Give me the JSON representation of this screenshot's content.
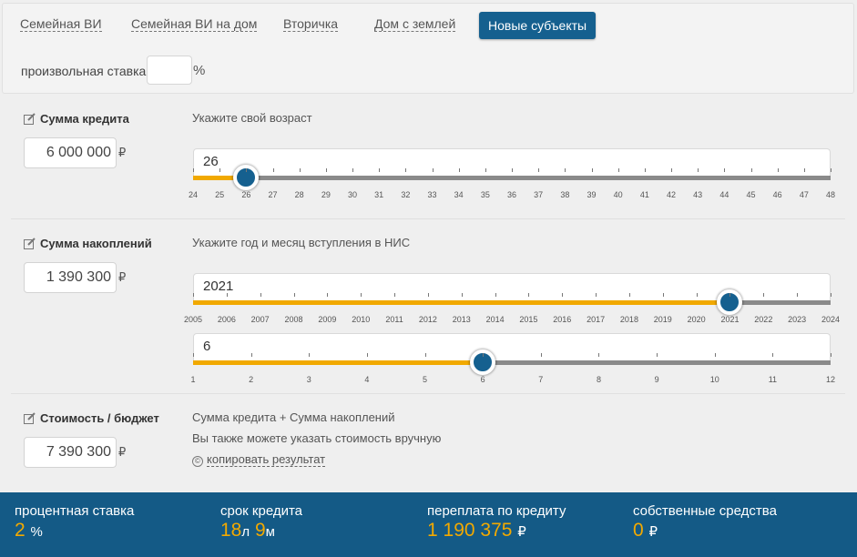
{
  "tabs": [
    {
      "label": "Семейная ВИ",
      "active": false
    },
    {
      "label": "Семейная ВИ на дом",
      "active": false
    },
    {
      "label": "Вторичка",
      "active": false
    },
    {
      "label": "Дом с землей",
      "active": false
    },
    {
      "label": "Новые субъекты",
      "active": true
    }
  ],
  "rate": {
    "label": "произвольная ставка",
    "value": "",
    "unit": "%"
  },
  "credit": {
    "title": "Сумма кредита",
    "amount": "6 000 000",
    "currency": "₽"
  },
  "savings": {
    "title": "Сумма накоплений",
    "amount": "1 390 300",
    "currency": "₽"
  },
  "budget": {
    "title": "Стоимость / бюджет",
    "amount": "7 390 300",
    "currency": "₽",
    "hint1": "Сумма кредита + Сумма накоплений",
    "hint2": "Вы также можете указать стоимость вручную",
    "copy_label": "копировать результат",
    "copy_icon": "©"
  },
  "age": {
    "hint": "Укажите свой возраст",
    "value": "26",
    "ticks": [
      "24",
      "25",
      "26",
      "27",
      "28",
      "29",
      "30",
      "31",
      "32",
      "33",
      "34",
      "35",
      "36",
      "37",
      "38",
      "39",
      "40",
      "41",
      "42",
      "43",
      "44",
      "45",
      "46",
      "47",
      "48"
    ]
  },
  "join": {
    "hint": "Укажите год и месяц вступления в НИС",
    "year": "2021",
    "year_ticks": [
      "2005",
      "2006",
      "2007",
      "2008",
      "2009",
      "2010",
      "2011",
      "2012",
      "2013",
      "2014",
      "2015",
      "2016",
      "2017",
      "2018",
      "2019",
      "2020",
      "2021",
      "2022",
      "2023",
      "2024"
    ],
    "month": "6",
    "month_ticks": [
      "1",
      "2",
      "3",
      "4",
      "5",
      "6",
      "7",
      "8",
      "9",
      "10",
      "11",
      "12"
    ]
  },
  "footer": {
    "rate": {
      "label": "процентная ставка",
      "value": "2",
      "unit": "%"
    },
    "term": {
      "label": "срок кредита",
      "years": "18",
      "years_unit": "л",
      "months": "9",
      "months_unit": "м"
    },
    "overpay": {
      "label": "переплата по кредиту",
      "value": "1 190 375",
      "unit": "₽"
    },
    "own": {
      "label": "собственные средства",
      "value": "0",
      "unit": "₽"
    }
  },
  "colors": {
    "accent": "#15608f",
    "fill": "#f1a900",
    "footer_bg": "#145a86"
  }
}
